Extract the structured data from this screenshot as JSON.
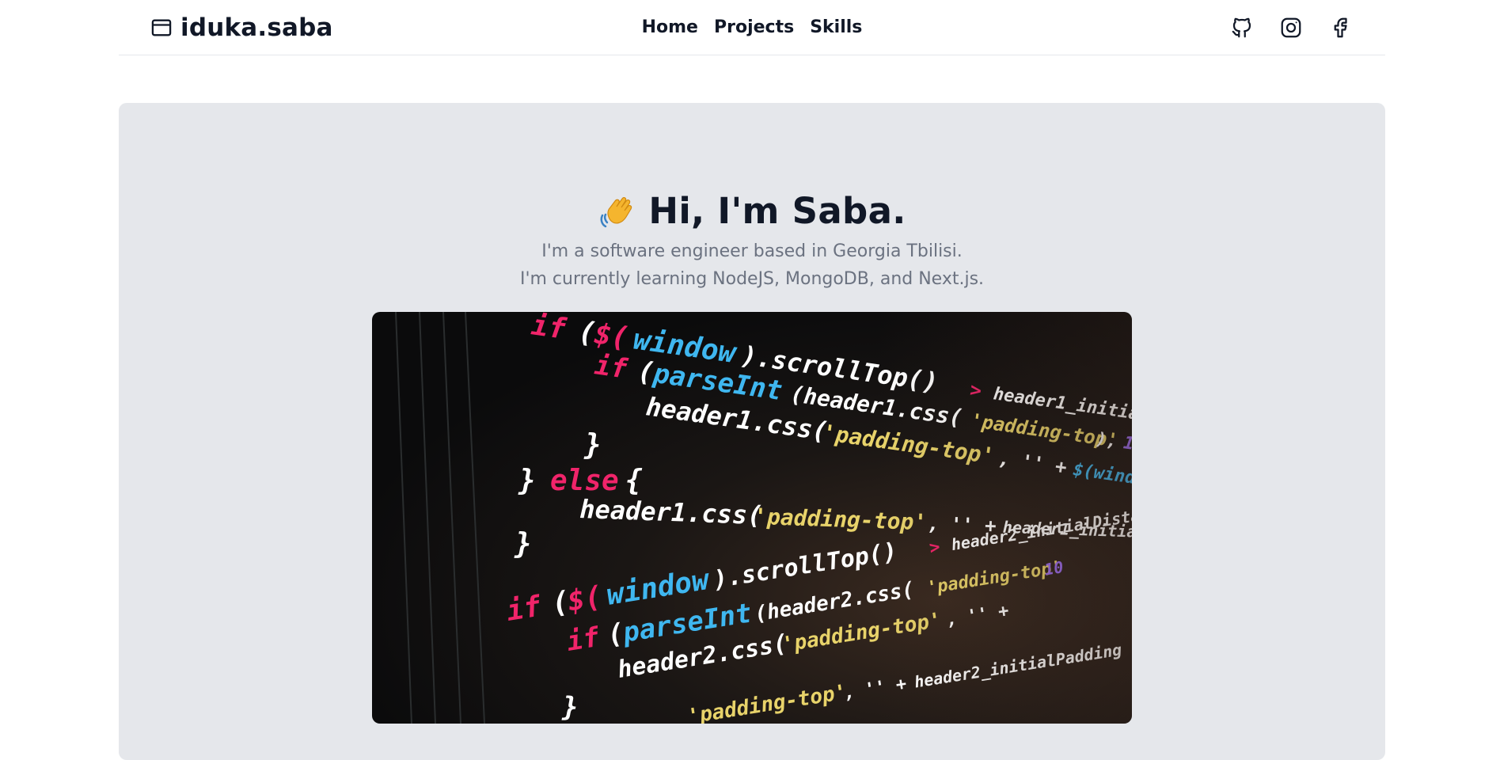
{
  "brand": {
    "name": "iduka.saba",
    "icon": "browser-window-icon"
  },
  "nav": {
    "items": [
      "Home",
      "Projects",
      "Skills"
    ]
  },
  "socials": [
    "github-icon",
    "instagram-icon",
    "facebook-icon"
  ],
  "hero": {
    "greeting_icon": "waving-hand-icon",
    "title": "Hi, I'm Saba.",
    "line1": "I'm a software engineer based in Georgia Tbilisi.",
    "line2": "I'm currently learning NodeJS, MongoDB, and Next.js."
  },
  "colors": {
    "hero_bg": "#e5e7eb",
    "subtitle": "#6b7280",
    "code_keyword": "#f0246a",
    "code_function": "#3fb7f0",
    "code_string": "#e8d36a",
    "code_text": "#ffffff"
  }
}
